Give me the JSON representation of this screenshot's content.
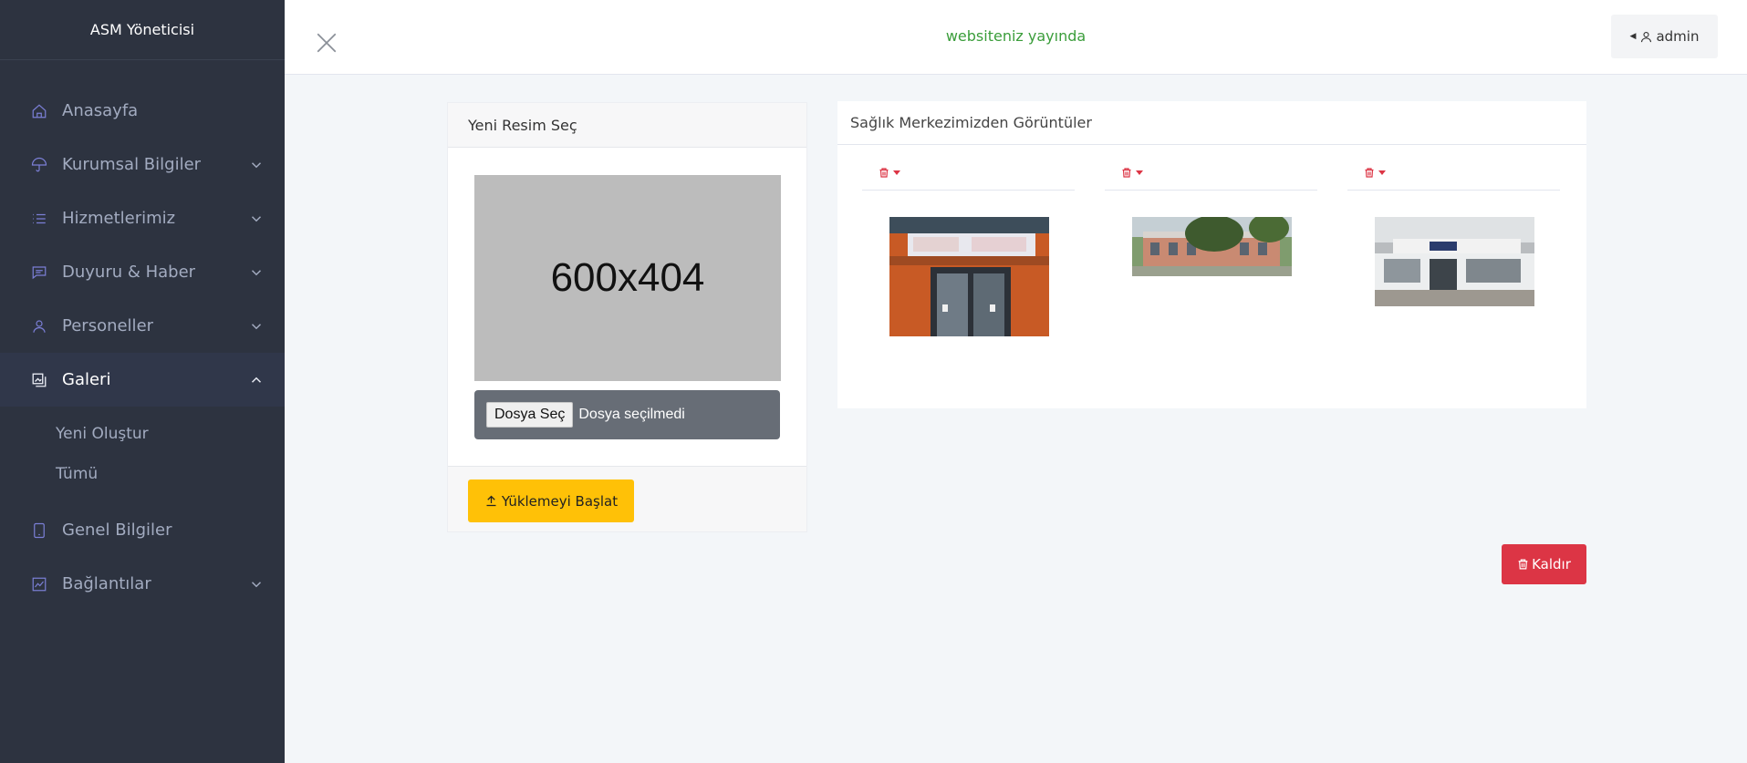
{
  "sidebar": {
    "brand": "ASM Yöneticisi",
    "items": [
      {
        "label": "Anasayfa",
        "icon": "home-icon"
      },
      {
        "label": "Kurumsal Bilgiler",
        "icon": "umbrella-icon"
      },
      {
        "label": "Hizmetlerimiz",
        "icon": "list-icon"
      },
      {
        "label": "Duyuru & Haber",
        "icon": "chat-icon"
      },
      {
        "label": "Personeller",
        "icon": "user-icon"
      },
      {
        "label": "Galeri",
        "icon": "gallery-icon"
      },
      {
        "label": "Genel Bilgiler",
        "icon": "tablet-icon"
      },
      {
        "label": "Bağlantılar",
        "icon": "chart-icon"
      }
    ],
    "galeri_sub": [
      "Yeni Oluştur",
      "Tümü"
    ]
  },
  "header": {
    "status": "websiteniz yayında",
    "admin_label": "admin"
  },
  "upload": {
    "title": "Yeni Resim Seç",
    "placeholder_text": "600x404",
    "file_button": "Dosya Seç",
    "file_status": "Dosya seçilmedi",
    "start_button": "Yüklemeyi Başlat"
  },
  "gallery": {
    "title": "Sağlık Merkezimizden Görüntüler",
    "images": [
      {
        "name": "health-center-entrance"
      },
      {
        "name": "health-center-building-trees"
      },
      {
        "name": "health-center-front"
      }
    ]
  },
  "remove_button": "Kaldır",
  "colors": {
    "sidebar_bg": "#2d3340",
    "status_green": "#3a9d3a",
    "warning": "#ffc107",
    "danger": "#dc3545"
  }
}
